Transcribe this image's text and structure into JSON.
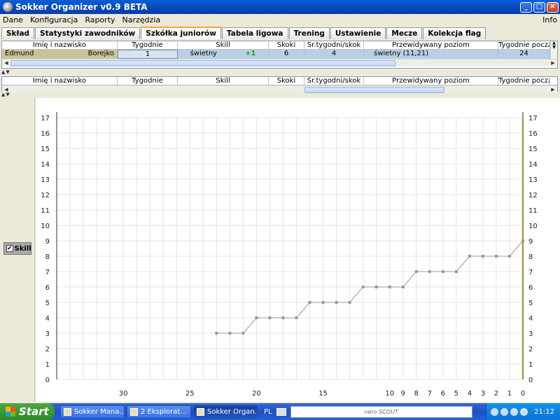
{
  "window": {
    "title": "Sokker Organizer v0.9 BETA",
    "btn_min": "_",
    "btn_max": "□",
    "btn_close": "×"
  },
  "menu": {
    "items": [
      "Dane",
      "Konfiguracja",
      "Raporty",
      "Narzędzia"
    ],
    "info": "Info"
  },
  "tabs": [
    "Skład",
    "Statystyki zawodników",
    "Szkółka juniorów",
    "Tabela ligowa",
    "Trening",
    "Ustawienie",
    "Mecze",
    "Kolekcja flag"
  ],
  "table": {
    "headers": [
      "Imię i nazwisko",
      "Tygodnie",
      "Skill",
      "Skoki",
      "Śr.tygodni/skok",
      "Przewidywany poziom",
      "Tygodnie począt"
    ],
    "row": {
      "first_name": "Edmund",
      "last_name": "Borejko",
      "weeks": "1",
      "skill": "świetny",
      "skill_delta": "+1",
      "jumps": "6",
      "avg_weeks": "4",
      "predicted": "świetny (11,21)",
      "start_weeks": "24"
    }
  },
  "table2": {
    "headers": [
      "Imię i nazwisko",
      "Tygodnie",
      "Skill",
      "Skoki",
      "Śr.tygodni/skok",
      "Przewidywany poziom",
      "Tygodnie począt"
    ]
  },
  "series_toggle": {
    "label": "Skill",
    "checked": true,
    "check_glyph": "✔"
  },
  "chart_data": {
    "type": "line",
    "ylim": [
      0,
      17
    ],
    "xlim": [
      35,
      0
    ],
    "y_ticks": [
      0,
      1,
      2,
      3,
      4,
      5,
      6,
      7,
      8,
      9,
      10,
      11,
      12,
      13,
      14,
      15,
      16,
      17
    ],
    "x_tick_labels": [
      30,
      25,
      20,
      15,
      10,
      9,
      8,
      7,
      6,
      5,
      4,
      3,
      2,
      1,
      0
    ],
    "grid": true,
    "series": [
      {
        "x": [
          23,
          22,
          21,
          20,
          19,
          18,
          17,
          16,
          15,
          14,
          13,
          12,
          11,
          10,
          9,
          8,
          7,
          6,
          5,
          4,
          3,
          2,
          1,
          0
        ],
        "values": [
          3,
          3,
          3,
          4,
          4,
          4,
          4,
          5,
          5,
          5,
          5,
          6,
          6,
          6,
          6,
          7,
          7,
          7,
          7,
          8,
          8,
          8,
          8,
          9
        ],
        "color": "#999999"
      }
    ],
    "highlight_x": 0,
    "highlight_color": "#fff2b0"
  },
  "taskbar": {
    "start": "Start",
    "buttons": [
      "Sokker Mana...",
      "2 Eksplorat...",
      "Sokker Organ..."
    ],
    "lang": "PL",
    "search_text": "nero SCOUT",
    "clock": "21:12"
  }
}
